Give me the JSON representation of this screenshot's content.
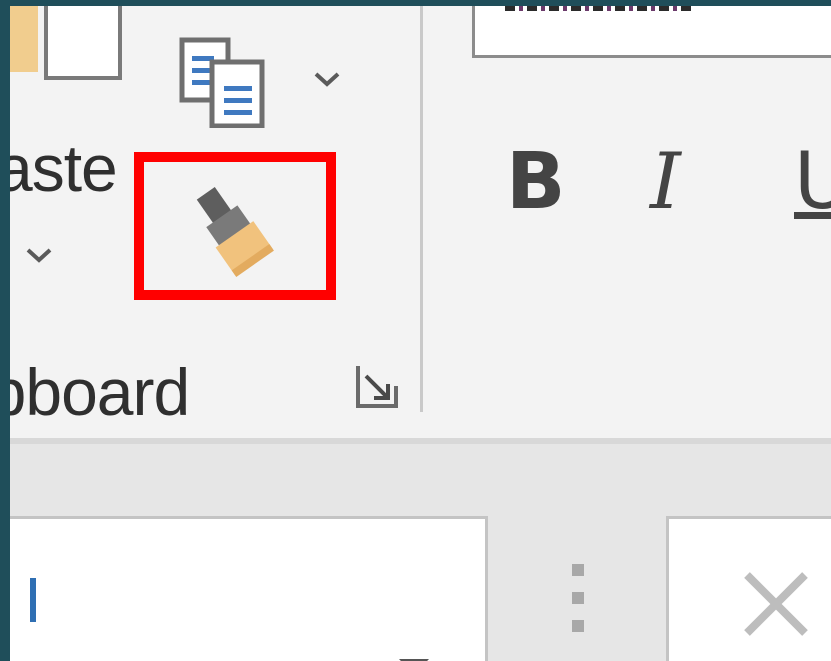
{
  "clipboard": {
    "paste_label": "aste",
    "group_label": "ipboard"
  },
  "font": {
    "bold_label": "B",
    "italic_label": "I",
    "underline_label": "U"
  },
  "icons": {
    "paste": "paste-icon",
    "copy": "copy-icon",
    "format_painter": "paintbrush-icon",
    "launcher": "dialog-launcher-icon",
    "dropdown": "chevron-down-icon",
    "close": "close-icon"
  },
  "colors": {
    "highlight": "#ff0000",
    "ribbon_bg": "#f3f3f3",
    "brush_bristles": "#f1c27d",
    "brush_handle": "#6b6b6b",
    "accent": "#2f6fb3"
  }
}
